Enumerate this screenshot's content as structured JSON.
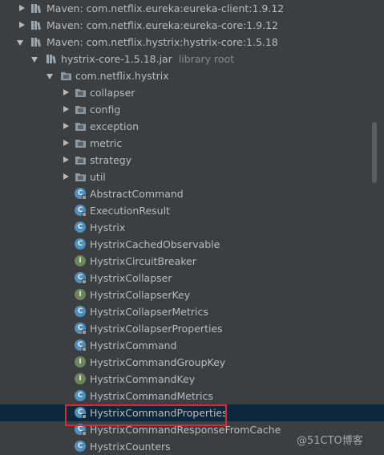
{
  "tree": {
    "maven": [
      {
        "label": "Maven: com.netflix.eureka:eureka-client:1.9.12"
      },
      {
        "label": "Maven: com.netflix.eureka:eureka-core:1.9.12"
      },
      {
        "label": "Maven: com.netflix.hystrix:hystrix-core:1.5.18"
      }
    ],
    "jar": {
      "label": "hystrix-core-1.5.18.jar",
      "note": "library root"
    },
    "package": {
      "label": "com.netflix.hystrix"
    },
    "subpackages": [
      {
        "label": "collapser"
      },
      {
        "label": "config"
      },
      {
        "label": "exception"
      },
      {
        "label": "metric"
      },
      {
        "label": "strategy"
      },
      {
        "label": "util"
      }
    ],
    "classes": [
      {
        "label": "AbstractCommand",
        "kind": "C"
      },
      {
        "label": "ExecutionResult",
        "kind": "C"
      },
      {
        "label": "Hystrix",
        "kind": "C"
      },
      {
        "label": "HystrixCachedObservable",
        "kind": "C"
      },
      {
        "label": "HystrixCircuitBreaker",
        "kind": "I"
      },
      {
        "label": "HystrixCollapser",
        "kind": "C"
      },
      {
        "label": "HystrixCollapserKey",
        "kind": "I"
      },
      {
        "label": "HystrixCollapserMetrics",
        "kind": "C"
      },
      {
        "label": "HystrixCollapserProperties",
        "kind": "C"
      },
      {
        "label": "HystrixCommand",
        "kind": "C"
      },
      {
        "label": "HystrixCommandGroupKey",
        "kind": "I"
      },
      {
        "label": "HystrixCommandKey",
        "kind": "I"
      },
      {
        "label": "HystrixCommandMetrics",
        "kind": "C"
      },
      {
        "label": "HystrixCommandProperties",
        "kind": "C",
        "selected": true
      },
      {
        "label": "HystrixCommandResponseFromCache",
        "kind": "C"
      },
      {
        "label": "HystrixCounters",
        "kind": "C"
      }
    ]
  },
  "watermark": "@51CTO博客",
  "colors": {
    "background": "#3c3f41",
    "selection": "#0d293e",
    "highlight": "#e0262f"
  }
}
